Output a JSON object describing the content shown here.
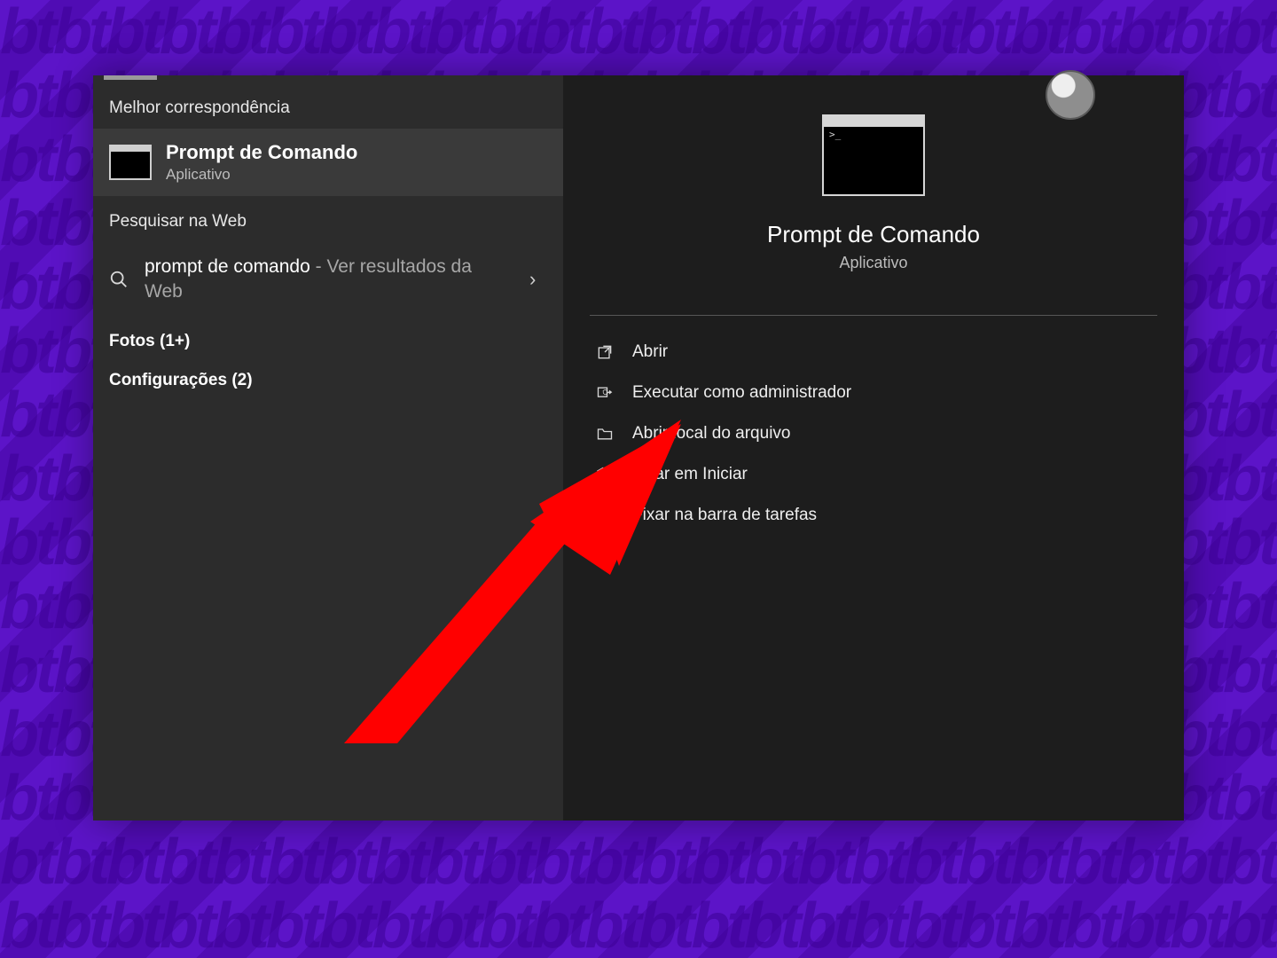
{
  "bg_watermark_glyph": "bt",
  "left": {
    "best_match_heading": "Melhor correspondência",
    "best_match": {
      "title": "Prompt de Comando",
      "subtitle": "Aplicativo",
      "icon": "cmd-icon"
    },
    "web_heading": "Pesquisar na Web",
    "web_item": {
      "query": "prompt de comando",
      "suffix": " - Ver resultados da Web"
    },
    "filters": [
      {
        "label": "Fotos",
        "count": "1+"
      },
      {
        "label": "Configurações",
        "count": "2"
      }
    ]
  },
  "right": {
    "title": "Prompt de Comando",
    "subtitle": "Aplicativo",
    "actions": [
      {
        "icon": "open-icon",
        "label": "Abrir"
      },
      {
        "icon": "admin-icon",
        "label": "Executar como administrador"
      },
      {
        "icon": "folder-icon",
        "label": "Abrir local do arquivo"
      },
      {
        "icon": "pin-start-icon",
        "label": "Fixar em Iniciar"
      },
      {
        "icon": "pin-taskbar-icon",
        "label": "Fixar na barra de tarefas"
      }
    ]
  },
  "annotation": {
    "type": "arrow",
    "color": "#ff0000",
    "points_to": "action-open"
  }
}
